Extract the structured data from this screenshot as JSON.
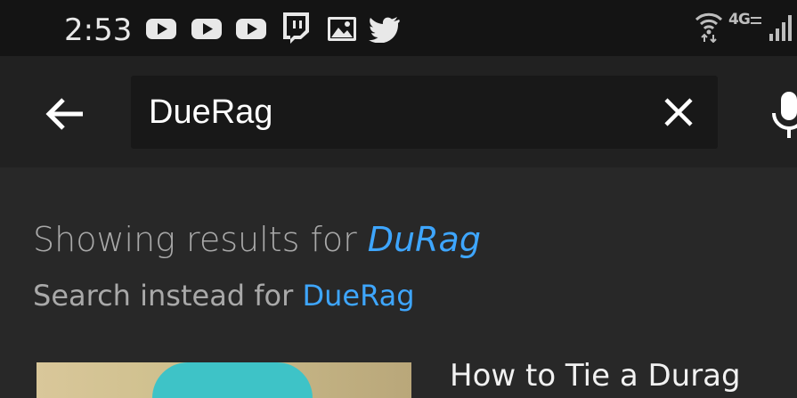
{
  "status_bar": {
    "time": "2:53",
    "notification_icons": [
      "youtube-icon",
      "youtube-icon",
      "youtube-icon",
      "twitch-icon",
      "image-icon",
      "twitter-icon"
    ],
    "network_label": "4G",
    "system_icons": [
      "wifi-icon",
      "network-4g-icon",
      "signal-icon"
    ]
  },
  "search": {
    "query": "DueRag",
    "back_icon": "arrow-left-icon",
    "clear_icon": "close-icon",
    "mic_icon": "microphone-icon"
  },
  "correction": {
    "showing_prefix": "Showing results for ",
    "corrected_query": "DuRag",
    "instead_prefix": "Search instead for ",
    "original_query": "DueRag"
  },
  "results": [
    {
      "title": "How to Tie a Durag"
    }
  ],
  "colors": {
    "status_bar_bg": "#141414",
    "app_bar_bg": "#212121",
    "page_bg": "#282828",
    "link_blue": "#3ea6ff"
  }
}
